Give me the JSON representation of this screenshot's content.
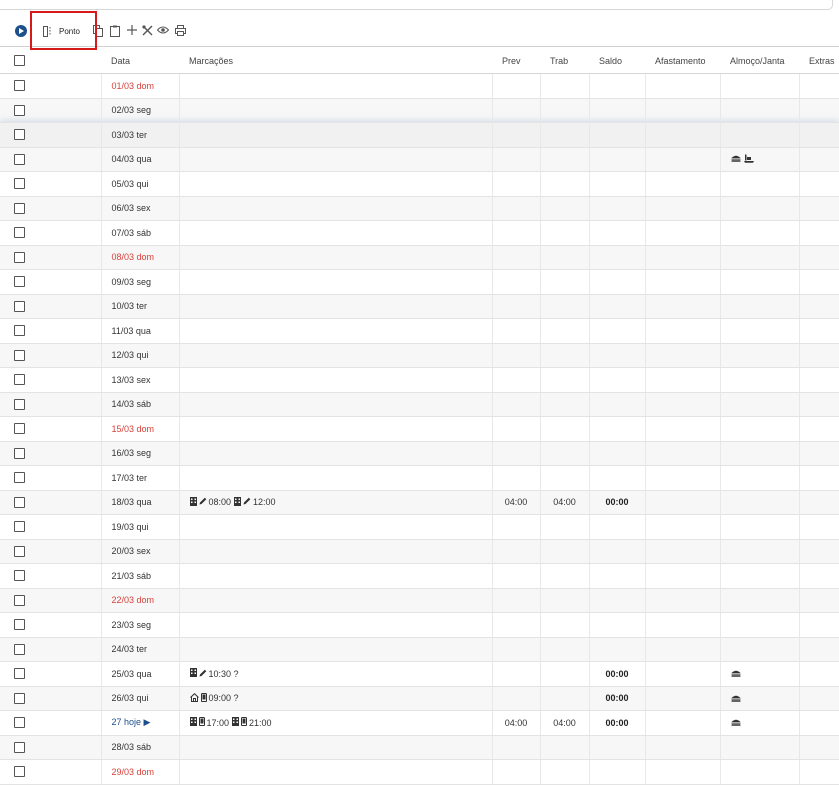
{
  "toolbar": {
    "ponto_label": "Ponto",
    "icons": [
      "play-icon",
      "split-columns-icon",
      "copy-icon",
      "clipboard-icon",
      "plus-icon",
      "tools-icon",
      "eye-icon",
      "print-icon"
    ]
  },
  "columns": {
    "data": "Data",
    "marcacoes": "Marcações",
    "prev": "Prev",
    "trab": "Trab",
    "saldo": "Saldo",
    "afastamento": "Afastamento",
    "almoco": "Almoço/Janta",
    "extras": "Extras"
  },
  "rows": [
    {
      "date": "01/03 dom",
      "color": "red",
      "marks": [],
      "prev": "",
      "trab": "",
      "saldo": "",
      "meals": []
    },
    {
      "date": "02/03 seg",
      "color": "dark",
      "marks": [],
      "prev": "",
      "trab": "",
      "saldo": "",
      "meals": []
    },
    {
      "date": "03/03 ter",
      "color": "dark",
      "marks": [],
      "prev": "",
      "trab": "",
      "saldo": "",
      "meals": [],
      "highlight": true
    },
    {
      "date": "04/03 qua",
      "color": "dark",
      "marks": [],
      "prev": "",
      "trab": "",
      "saldo": "",
      "meals": [
        "burger-icon",
        "ship-icon"
      ]
    },
    {
      "date": "05/03 qui",
      "color": "dark",
      "marks": [],
      "prev": "",
      "trab": "",
      "saldo": "",
      "meals": []
    },
    {
      "date": "06/03 sex",
      "color": "dark",
      "marks": [],
      "prev": "",
      "trab": "",
      "saldo": "",
      "meals": []
    },
    {
      "date": "07/03 sáb",
      "color": "dark",
      "marks": [],
      "prev": "",
      "trab": "",
      "saldo": "",
      "meals": []
    },
    {
      "date": "08/03 dom",
      "color": "red",
      "marks": [],
      "prev": "",
      "trab": "",
      "saldo": "",
      "meals": []
    },
    {
      "date": "09/03 seg",
      "color": "dark",
      "marks": [],
      "prev": "",
      "trab": "",
      "saldo": "",
      "meals": []
    },
    {
      "date": "10/03 ter",
      "color": "dark",
      "marks": [],
      "prev": "",
      "trab": "",
      "saldo": "",
      "meals": []
    },
    {
      "date": "11/03 qua",
      "color": "dark",
      "marks": [],
      "prev": "",
      "trab": "",
      "saldo": "",
      "meals": []
    },
    {
      "date": "12/03 qui",
      "color": "dark",
      "marks": [],
      "prev": "",
      "trab": "",
      "saldo": "",
      "meals": []
    },
    {
      "date": "13/03 sex",
      "color": "dark",
      "marks": [],
      "prev": "",
      "trab": "",
      "saldo": "",
      "meals": []
    },
    {
      "date": "14/03 sáb",
      "color": "dark",
      "marks": [],
      "prev": "",
      "trab": "",
      "saldo": "",
      "meals": []
    },
    {
      "date": "15/03 dom",
      "color": "red",
      "marks": [],
      "prev": "",
      "trab": "",
      "saldo": "",
      "meals": []
    },
    {
      "date": "16/03 seg",
      "color": "dark",
      "marks": [],
      "prev": "",
      "trab": "",
      "saldo": "",
      "meals": []
    },
    {
      "date": "17/03 ter",
      "color": "dark",
      "marks": [],
      "prev": "",
      "trab": "",
      "saldo": "",
      "meals": []
    },
    {
      "date": "18/03 qua",
      "color": "dark",
      "marks": [
        {
          "icons": [
            "building-icon",
            "pencil-icon"
          ],
          "time": "08:00"
        },
        {
          "icons": [
            "building-icon",
            "pencil-icon"
          ],
          "time": "12:00"
        }
      ],
      "prev": "04:00",
      "trab": "04:00",
      "saldo": "00:00",
      "meals": []
    },
    {
      "date": "19/03 qui",
      "color": "dark",
      "marks": [],
      "prev": "",
      "trab": "",
      "saldo": "",
      "meals": []
    },
    {
      "date": "20/03 sex",
      "color": "dark",
      "marks": [],
      "prev": "",
      "trab": "",
      "saldo": "",
      "meals": []
    },
    {
      "date": "21/03 sáb",
      "color": "dark",
      "marks": [],
      "prev": "",
      "trab": "",
      "saldo": "",
      "meals": []
    },
    {
      "date": "22/03 dom",
      "color": "red",
      "marks": [],
      "prev": "",
      "trab": "",
      "saldo": "",
      "meals": []
    },
    {
      "date": "23/03 seg",
      "color": "dark",
      "marks": [],
      "prev": "",
      "trab": "",
      "saldo": "",
      "meals": []
    },
    {
      "date": "24/03 ter",
      "color": "dark",
      "marks": [],
      "prev": "",
      "trab": "",
      "saldo": "",
      "meals": []
    },
    {
      "date": "25/03 qua",
      "color": "dark",
      "marks": [
        {
          "icons": [
            "building-icon",
            "pencil-icon"
          ],
          "time": "10:30 ?"
        }
      ],
      "prev": "",
      "trab": "",
      "saldo": "00:00",
      "meals": [
        "burger-icon"
      ]
    },
    {
      "date": "26/03 qui",
      "color": "dark",
      "marks": [
        {
          "icons": [
            "home-icon",
            "phone-icon"
          ],
          "time": "09:00 ?"
        }
      ],
      "prev": "",
      "trab": "",
      "saldo": "00:00",
      "meals": [
        "burger-icon"
      ]
    },
    {
      "date": "27 hoje ▶",
      "color": "blue",
      "marks": [
        {
          "icons": [
            "building-icon",
            "phone-icon"
          ],
          "time": "17:00"
        },
        {
          "icons": [
            "building-icon",
            "phone-icon"
          ],
          "time": "21:00"
        }
      ],
      "prev": "04:00",
      "trab": "04:00",
      "saldo": "00:00",
      "meals": [
        "burger-icon"
      ]
    },
    {
      "date": "28/03 sáb",
      "color": "dark",
      "marks": [],
      "prev": "",
      "trab": "",
      "saldo": "",
      "meals": []
    },
    {
      "date": "29/03 dom",
      "color": "red",
      "marks": [],
      "prev": "",
      "trab": "",
      "saldo": "",
      "meals": []
    }
  ],
  "colors": {
    "red": "#d6413a",
    "blue": "#1d4f8c",
    "dark": "#333333",
    "highlight_box": "#d61a1a"
  }
}
